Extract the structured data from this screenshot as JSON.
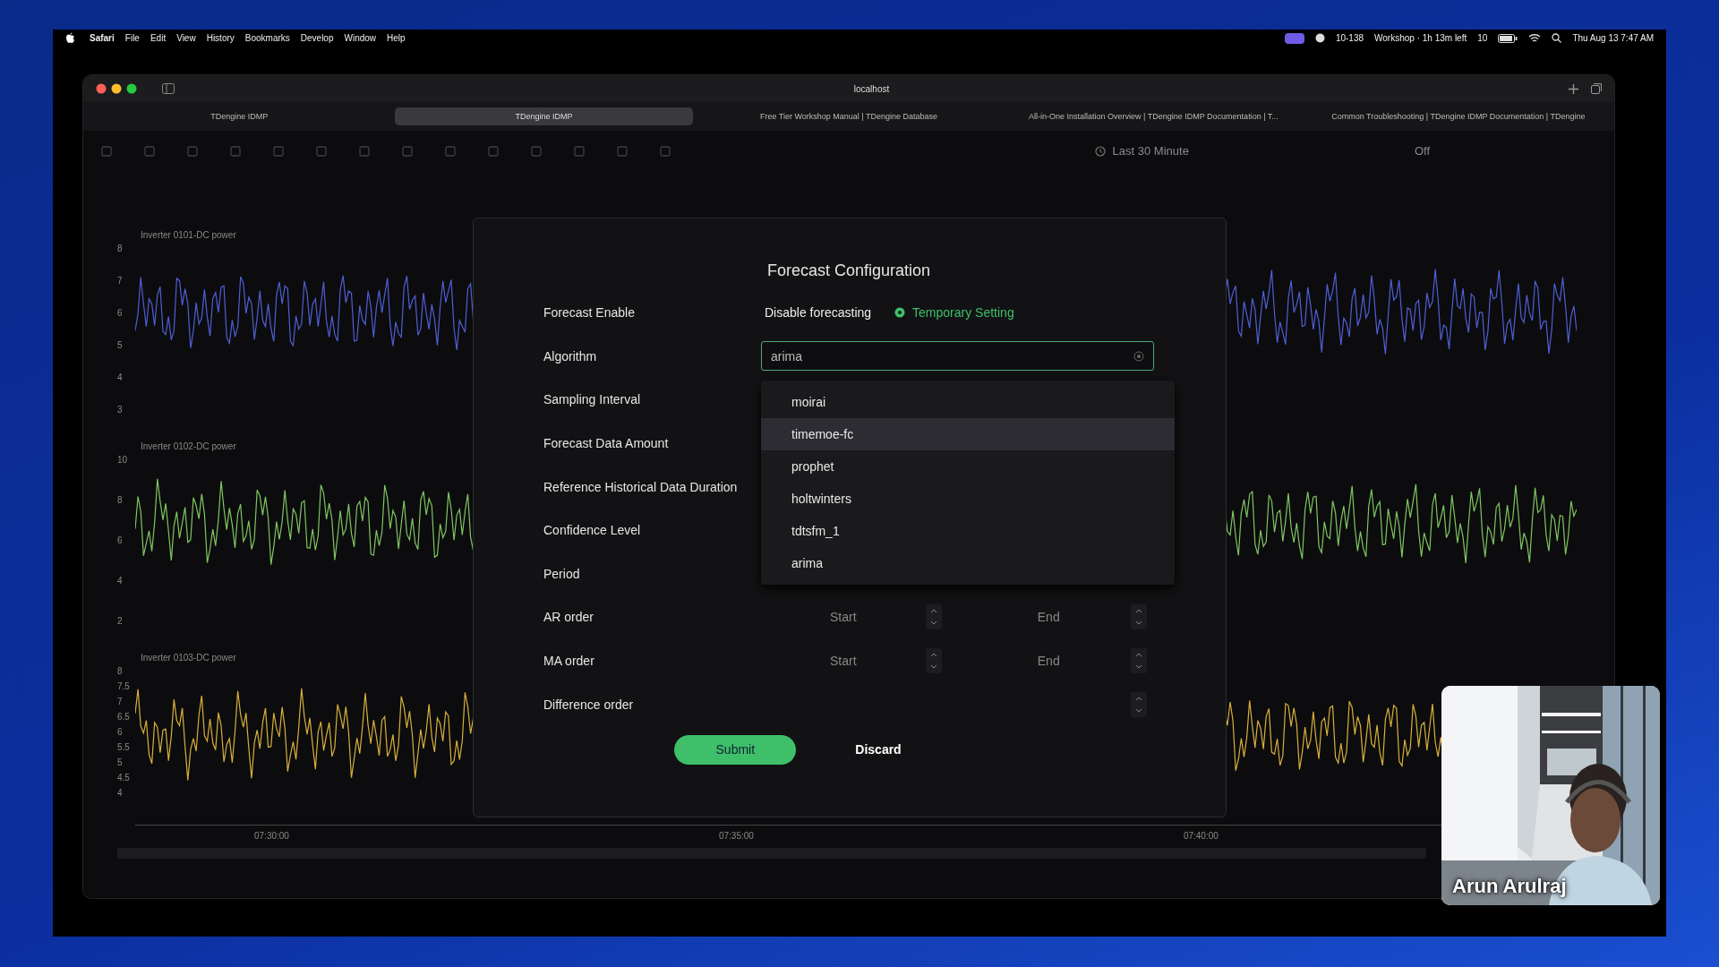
{
  "menu_bar": {
    "app": "Safari",
    "items": [
      "File",
      "Edit",
      "View",
      "History",
      "Bookmarks",
      "Develop",
      "Window",
      "Help"
    ],
    "status": [
      "10-138",
      "Workshop · 1h 13m left",
      "10"
    ],
    "clock": "Thu Aug 13 7:47 AM"
  },
  "browser": {
    "address": "localhost",
    "tabs": [
      {
        "title": "TDengine IDMP",
        "selected": false
      },
      {
        "title": "TDengine IDMP",
        "selected": true
      },
      {
        "title": "Free Tier Workshop Manual | TDengine Database",
        "selected": false
      },
      {
        "title": "All-in-One Installation Overview | TDengine IDMP Documentation | T...",
        "selected": false
      },
      {
        "title": "Common Troubleshooting | TDengine IDMP Documentation | TDengine",
        "selected": false
      }
    ]
  },
  "toolbar": {
    "time_range": "Last 30 Minute",
    "refresh": "Off"
  },
  "panels": [
    {
      "title": "Inverter 0101-DC power",
      "color": "#4f5fd6",
      "ticks": [
        "8",
        "7",
        "6",
        "5",
        "4",
        "3"
      ]
    },
    {
      "title": "Inverter 0102-DC power",
      "color": "#7fc760",
      "ticks": [
        "10",
        "8",
        "6",
        "4",
        "2"
      ]
    },
    {
      "title": "Inverter 0103-DC power",
      "color": "#d9b03a",
      "ticks": [
        "8",
        "7.5",
        "7",
        "6.5",
        "6",
        "5.5",
        "5",
        "4.5",
        "4"
      ]
    }
  ],
  "x_axis": [
    "07:30:00",
    "07:35:00",
    "07:40:00"
  ],
  "dialog": {
    "title": "Forecast Configuration",
    "fields": [
      {
        "label": "Forecast Enable",
        "kind": "radio",
        "options": [
          {
            "label": "Disable forecasting",
            "selected": false
          },
          {
            "label": "Temporary Setting",
            "selected": true
          }
        ]
      },
      {
        "label": "Algorithm",
        "kind": "select",
        "value": "arima",
        "expanded": true
      },
      {
        "label": "Sampling Interval"
      },
      {
        "label": "Forecast Data Amount"
      },
      {
        "label": "Reference Historical Data Duration"
      },
      {
        "label": "Confidence Level"
      },
      {
        "label": "Period"
      },
      {
        "label": "AR order",
        "kind": "range",
        "start_placeholder": "Start",
        "end_placeholder": "End"
      },
      {
        "label": "MA order",
        "kind": "range",
        "start_placeholder": "Start",
        "end_placeholder": "End"
      },
      {
        "label": "Difference order",
        "kind": "number"
      }
    ],
    "dropdown": [
      {
        "label": "moirai",
        "highlighted": false
      },
      {
        "label": "timemoe-fc",
        "highlighted": true
      },
      {
        "label": "prophet",
        "highlighted": false
      },
      {
        "label": "holtwinters",
        "highlighted": false
      },
      {
        "label": "tdtsfm_1",
        "highlighted": false
      },
      {
        "label": "arima",
        "highlighted": false
      }
    ],
    "buttons": [
      {
        "label": "Submit",
        "kind": "primary"
      },
      {
        "label": "Discard",
        "kind": "text"
      }
    ]
  },
  "video": {
    "kind": "picture",
    "caption": "Arun Arulraj"
  }
}
